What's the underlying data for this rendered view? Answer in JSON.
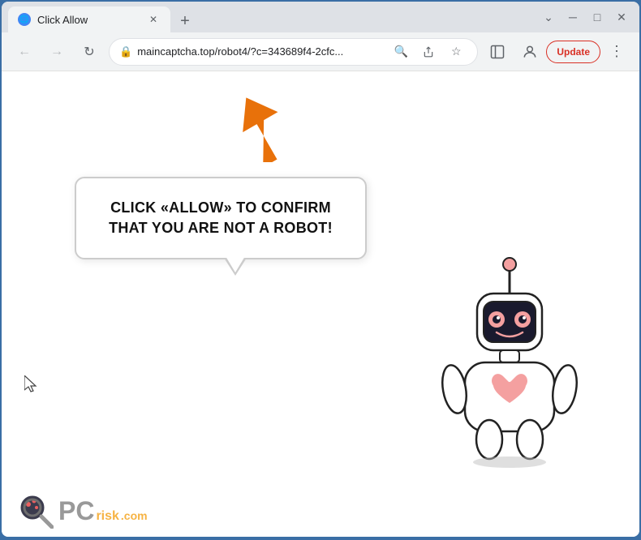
{
  "browser": {
    "tab": {
      "title": "Click Allow",
      "favicon": "🌐"
    },
    "newTab": "+",
    "window_controls": {
      "chevron_down": "⌄",
      "minimize": "─",
      "maximize": "□",
      "close": "✕"
    },
    "nav": {
      "back": "←",
      "forward": "→",
      "reload": "↻"
    },
    "address": "maincaptcha.top/robot4/?c=343689f4-2cfc...",
    "toolbar_icons": {
      "search": "🔍",
      "share": "⬆",
      "bookmark": "☆",
      "sidebar": "▣",
      "profile": "👤"
    },
    "update_label": "Update",
    "more": "⋮"
  },
  "page": {
    "bubble_text": "CLICK «ALLOW» TO CONFIRM THAT YOU ARE NOT A ROBOT!",
    "watermark": {
      "pc": "PC",
      "risk": "risk",
      "com": ".com"
    }
  }
}
